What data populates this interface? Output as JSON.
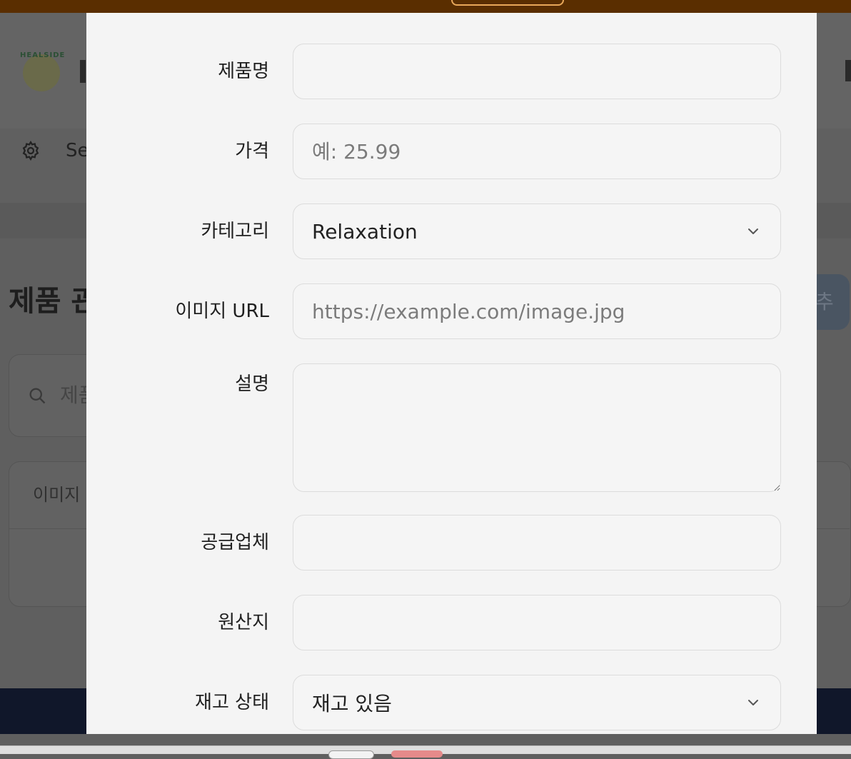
{
  "background": {
    "nav_label": "Se",
    "page_title": "제품 관",
    "add_button_label": "추가",
    "search_placeholder": "제품",
    "table_header_image": "이미지",
    "logo_text": "HEALSIDE"
  },
  "form": {
    "name": {
      "label": "제품명",
      "value": "",
      "placeholder": ""
    },
    "price": {
      "label": "가격",
      "value": "",
      "placeholder": "예: 25.99"
    },
    "category": {
      "label": "카테고리",
      "selected": "Relaxation"
    },
    "image_url": {
      "label": "이미지 URL",
      "value": "",
      "placeholder": "https://example.com/image.jpg"
    },
    "description": {
      "label": "설명",
      "value": "",
      "placeholder": ""
    },
    "supplier": {
      "label": "공급업체",
      "value": "",
      "placeholder": ""
    },
    "origin": {
      "label": "원산지",
      "value": "",
      "placeholder": ""
    },
    "stock_status": {
      "label": "재고 상태",
      "selected": "재고 있음"
    }
  },
  "icons": {
    "nav": "gear-icon",
    "search": "search-icon",
    "dropdown": "chevron-down-icon"
  }
}
